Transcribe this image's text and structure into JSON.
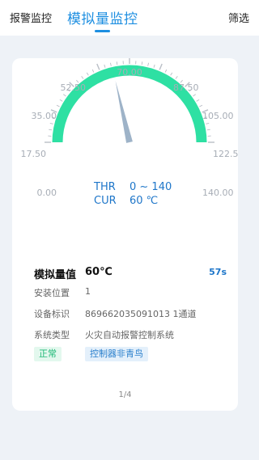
{
  "header": {
    "tabs": [
      {
        "label": "报警监控",
        "active": false
      },
      {
        "label": "模拟量监控",
        "active": true
      }
    ],
    "filter_label": "筛选"
  },
  "gauge": {
    "min": 0,
    "max": 140,
    "ticks": [
      "0.00",
      "17.50",
      "35.00",
      "52.50",
      "70.00",
      "87.50",
      "105.00",
      "122.5",
      "140.00"
    ],
    "current_value": 60,
    "arc_color": "#2ee0a3",
    "needle_color": "#9eb3c8",
    "thr_label": "THR",
    "thr_value": "0 ~ 140",
    "cur_label": "CUR",
    "cur_value": "60 ℃"
  },
  "details": {
    "name_label": "模拟量值",
    "name_value": "60℃",
    "countdown": "57s",
    "rows": [
      {
        "label": "安装位置",
        "value": "1"
      },
      {
        "label": "设备标识",
        "value": "869662035091013 1通道"
      },
      {
        "label": "系统类型",
        "value": "火灾自动报警控制系统"
      }
    ],
    "status": "正常",
    "controller": "控制器非青鸟"
  },
  "pager": "1/4"
}
